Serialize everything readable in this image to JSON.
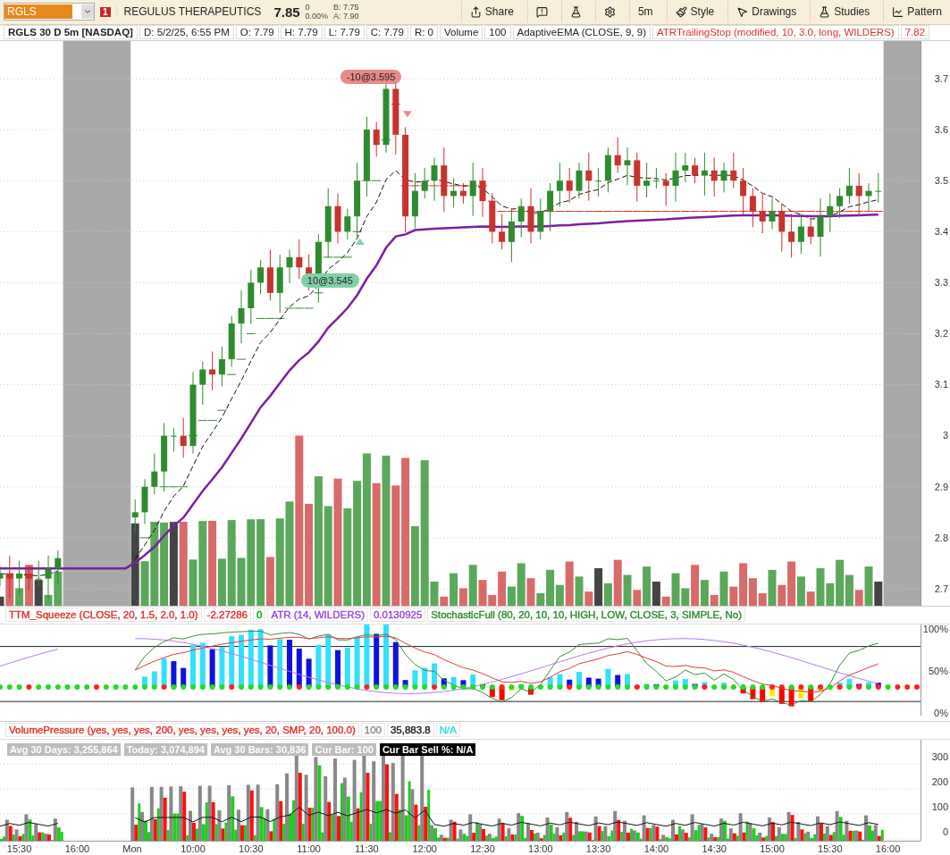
{
  "toolbar": {
    "symbol": "RGLS",
    "alert_badge": "1",
    "company": "REGULUS THERAPEUTICS",
    "last": "7.85",
    "change": "0",
    "change_pct": "0.00%",
    "bid": "B: 7.75",
    "ask": "A: 7.90",
    "buttons": [
      {
        "kind": "share",
        "label": "Share"
      },
      {
        "kind": "alert"
      },
      {
        "kind": "flask"
      },
      {
        "kind": "gear"
      },
      {
        "kind": "text",
        "label": "5m"
      },
      {
        "kind": "style",
        "label": "Style"
      },
      {
        "kind": "drawings",
        "label": "Drawings"
      },
      {
        "kind": "studies",
        "label": "Studies"
      },
      {
        "kind": "pattern",
        "label": "Pattern"
      }
    ]
  },
  "header": [
    {
      "text": "RGLS 30 D 5m [NASDAQ]",
      "kind": "title"
    },
    {
      "text": "D: 5/2/25, 6:55 PM",
      "kind": "plain"
    },
    {
      "text": "O: 7.79",
      "kind": "plain"
    },
    {
      "text": "H: 7.79",
      "kind": "plain"
    },
    {
      "text": "L: 7.79",
      "kind": "plain"
    },
    {
      "text": "C: 7.79",
      "kind": "plain"
    },
    {
      "text": "R: 0",
      "kind": "plain"
    },
    {
      "text": "Volume",
      "kind": "plain"
    },
    {
      "text": "100",
      "kind": "plain"
    },
    {
      "text": "AdaptiveEMA (CLOSE, 9, 9)",
      "kind": "plain"
    },
    {
      "text": "ATRTrailingStop (modified, 10, 3.0, long, WILDERS)",
      "kind": "study"
    },
    {
      "text": "7.82",
      "kind": "study"
    }
  ],
  "price_chart": {
    "trade_markers": [
      {
        "kind": "sell",
        "text": "-10@3.595"
      },
      {
        "kind": "buy",
        "text": "10@3.545"
      }
    ],
    "price_axis": [
      "3.7",
      "3.6",
      "3.5",
      "3.4",
      "3.3",
      "3.2",
      "3.1",
      "3",
      "2.9",
      "2.8",
      "2.7"
    ]
  },
  "lower_studies": [
    {
      "text": "TTM_Squeeze (CLOSE, 20, 1.5, 2.0, 1.0)",
      "color": "#e0302c"
    },
    {
      "text": "-2.27286",
      "color": "#e0302c"
    },
    {
      "text": "0",
      "color": "#00b000"
    },
    {
      "text": "ATR (14, WILDERS)",
      "color": "#9b45e0"
    },
    {
      "text": "0.0130925",
      "color": "#9b45e0"
    },
    {
      "text": "StochasticFull (80, 20, 10, 10, HIGH, LOW, CLOSE, 3, SIMPLE, No)",
      "color": "#2e8b2e"
    }
  ],
  "lower_axis": [
    "100%",
    "50%",
    "0%"
  ],
  "volume_studies": [
    {
      "text": "VolumePressure (yes, yes, yes, 200, yes, yes, yes, yes, 20, SMP, 20, 100.0)",
      "color": "#e0302c"
    },
    {
      "text": "100",
      "color": "#888888"
    },
    {
      "text": "35,883.8",
      "color": "#222222"
    },
    {
      "text": "N/A",
      "color": "#33dddd"
    }
  ],
  "volume_stats": [
    {
      "text": "Avg 30 Days: 3,255,864",
      "kind": "gray"
    },
    {
      "text": "Today: 3,074,894",
      "kind": "gray"
    },
    {
      "text": "Avg 30 Bars: 30,836",
      "kind": "gray"
    },
    {
      "text": "Cur Bar: 100",
      "kind": "gray"
    },
    {
      "text": "Cur Bar Sell %: N/A",
      "kind": "black"
    }
  ],
  "volume_axis": [
    "300",
    "200",
    "100",
    "0"
  ],
  "time_axis": [
    "15:30",
    "16:00",
    "Mon",
    "10:00",
    "10:30",
    "11:00",
    "11:30",
    "12:00",
    "12:30",
    "13:00",
    "13:30",
    "14:00",
    "14:30",
    "15:00",
    "15:30",
    "16:00"
  ]
}
